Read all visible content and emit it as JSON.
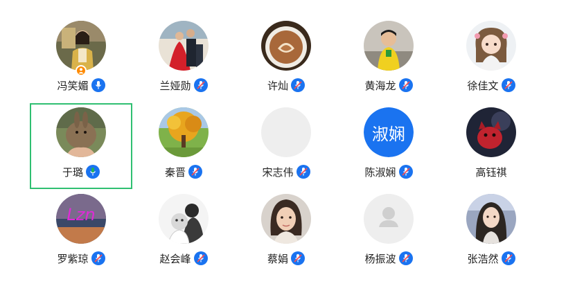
{
  "colors": {
    "accent_blue": "#1a73f0",
    "active_green": "#21b25a",
    "selection_border": "#2fbf71",
    "badge_orange": "#ff8a00"
  },
  "participants": [
    {
      "name": "冯笑媚",
      "avatar": "photo-woman-sitting",
      "mic": "active-blue",
      "badge": "person-icon"
    },
    {
      "name": "兰娅勋",
      "avatar": "photo-couple-red-dress",
      "mic": "muted"
    },
    {
      "name": "许灿",
      "avatar": "photo-latte-art",
      "mic": "muted"
    },
    {
      "name": "黄海龙",
      "avatar": "photo-child-yellow",
      "mic": "muted"
    },
    {
      "name": "徐佳文",
      "avatar": "illustration-girl",
      "mic": "muted"
    },
    {
      "name": "于璐",
      "avatar": "photo-rabbit",
      "mic": "speaking-green",
      "selected": true
    },
    {
      "name": "秦晋",
      "avatar": "photo-autumn-tree",
      "mic": "muted"
    },
    {
      "name": "宋志伟",
      "avatar": "blank-gray",
      "mic": "muted"
    },
    {
      "name": "陈淑娴",
      "avatar": "text-avatar",
      "avatar_text": "淑娴",
      "mic": "muted"
    },
    {
      "name": "高钰祺",
      "avatar": "illustration-red-cat",
      "mic": "none"
    },
    {
      "name": "罗紫琼",
      "avatar": "graphic-lzn",
      "avatar_text": "Lzn",
      "mic": "muted"
    },
    {
      "name": "赵会峰",
      "avatar": "photo-mother-baby-bw",
      "mic": "muted"
    },
    {
      "name": "蔡娟",
      "avatar": "photo-woman-selfie",
      "mic": "muted"
    },
    {
      "name": "杨振波",
      "avatar": "default-person-placeholder",
      "mic": "muted"
    },
    {
      "name": "张浩然",
      "avatar": "photo-girl-portrait",
      "mic": "muted"
    }
  ]
}
